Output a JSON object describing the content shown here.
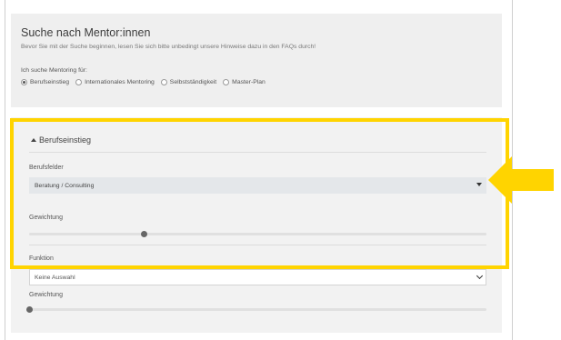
{
  "search": {
    "title": "Suche nach Mentor:innen",
    "hint": "Bevor Sie mit der Suche beginnen, lesen Sie sich bitte unbedingt unsere Hinweise dazu in den FAQs durch!",
    "mentoring_for_label": "Ich suche Mentoring für:",
    "options": [
      {
        "label": "Berufseinstieg",
        "selected": true
      },
      {
        "label": "Internationales Mentoring",
        "selected": false
      },
      {
        "label": "Selbstständigkeit",
        "selected": false
      },
      {
        "label": "Master-Plan",
        "selected": false
      }
    ]
  },
  "section": {
    "toggle_label": "Berufseinstieg",
    "fields": {
      "berufsfelder_label": "Berufsfelder",
      "berufsfelder_value": "Beratung / Consulting",
      "gewichtung1_label": "Gewichtung",
      "gewichtung1_value": 0.25,
      "funktion_label": "Funktion",
      "funktion_value": "Keine Auswahl",
      "gewichtung2_label": "Gewichtung",
      "gewichtung2_value": 0.0
    }
  },
  "annotation": {
    "highlight_color": "#ffd400",
    "arrow_color": "#ffd400"
  }
}
